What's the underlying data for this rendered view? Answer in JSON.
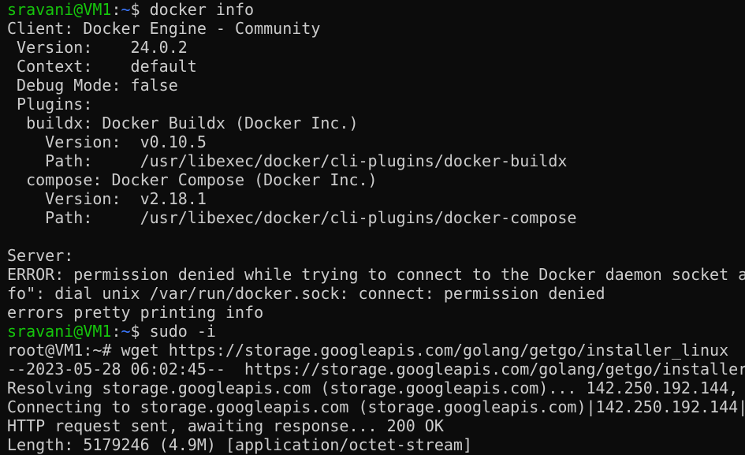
{
  "terminal": {
    "background": "#0c0c0c",
    "foreground": "#cccccc",
    "prompt_user_color": "#16c60c",
    "prompt_path_color": "#3b78ff",
    "prompt1": {
      "user_host": "sravani@VM1",
      "colon": ":",
      "path": "~",
      "symbol": "$ ",
      "command": "docker info"
    },
    "lines_a": [
      "Client: Docker Engine - Community",
      " Version:    24.0.2",
      " Context:    default",
      " Debug Mode: false",
      " Plugins:",
      "  buildx: Docker Buildx (Docker Inc.)",
      "    Version:  v0.10.5",
      "    Path:     /usr/libexec/docker/cli-plugins/docker-buildx",
      "  compose: Docker Compose (Docker Inc.)",
      "    Version:  v2.18.1",
      "    Path:     /usr/libexec/docker/cli-plugins/docker-compose",
      "",
      "Server:",
      "ERROR: permission denied while trying to connect to the Docker daemon socket a",
      "fo\": dial unix /var/run/docker.sock: connect: permission denied",
      "errors pretty printing info"
    ],
    "prompt2": {
      "user_host": "sravani@VM1",
      "colon": ":",
      "path": "~",
      "symbol": "$ ",
      "command": "sudo -i"
    },
    "lines_b": [
      "root@VM1:~# wget https://storage.googleapis.com/golang/getgo/installer_linux",
      "--2023-05-28 06:02:45--  https://storage.googleapis.com/golang/getgo/installer",
      "Resolving storage.googleapis.com (storage.googleapis.com)... 142.250.192.144,",
      "Connecting to storage.googleapis.com (storage.googleapis.com)|142.250.192.144|",
      "HTTP request sent, awaiting response... 200 OK",
      "Length: 5179246 (4.9M) [application/octet-stream]"
    ]
  }
}
